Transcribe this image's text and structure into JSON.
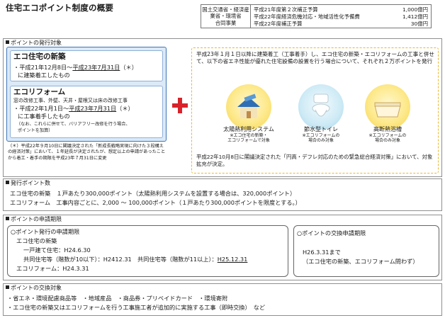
{
  "title": "住宅エコポイント制度の概要",
  "ministry": {
    "line1": "国土交通省・経済産業省・環境省",
    "line2": "合同事業"
  },
  "budget": [
    {
      "label": "平成21年度第２次補正予算",
      "amount": "1,000億円"
    },
    {
      "label": "平成22年度経済危機対応・地域活性化予備費",
      "amount": "1,412億円"
    },
    {
      "label": "平成22年度補正予算",
      "amount": "30億円"
    }
  ],
  "issue_target": {
    "heading": "ポイントの発行対象",
    "new_house": {
      "title": "エコ住宅の新築",
      "line1": "・平成21年12月8日〜",
      "line1_u": "平成23年7月31日",
      "line1_tail": "（＊）",
      "line2": "に建築着工したもの"
    },
    "reform": {
      "title": "エコリフォーム",
      "desc": "窓の改修工事、外壁、天井・屋根又は床の改修工事",
      "line1": "・平成22年1月1日〜",
      "line1_u": "平成23年7月31日",
      "line1_tail": "（＊）",
      "line2": "に工事着手したもの",
      "note1": "（なお、これらに併せて、バリアフリー改修を行う場合、",
      "note2": "ポイントを加算）"
    },
    "footnote": "（＊）平成22年９月10日に閣議決定された「新成長戦略実現に向けた３段構えの経済対策」において、１年延長が決定されたが、想定以上の申請があったことから着工・着手の期限を平成23年７月31日に変更",
    "combo_text": "平成23年１月１日以降に建築着工（工事着手）し、エコ住宅の新築・エコリフォームの工事と併せて、以下の省エネ性能が優れた住宅設備の設置を行う場合について、それぞれ２万ポイントを発行",
    "equipment": [
      {
        "icon": "solar-house-icon",
        "name": "太陽熱利用システム",
        "note1": "※エコ住宅の新築・",
        "note2": "エコリフォームで対象"
      },
      {
        "icon": "toilet-icon",
        "name": "節水型トイレ",
        "note1": "※エコリフォームの",
        "note2": "場合のみ対象"
      },
      {
        "icon": "bathtub-icon",
        "name": "高断熱浴槽",
        "note1": "※エコリフォームの",
        "note2": "場合のみ対象"
      }
    ],
    "combo_foot": "平成22年10月8日に閣議決定された「円高・デフレ対応のための緊急総合経済対策」において、対象拡充が決定。"
  },
  "issue_points": {
    "heading": "発行ポイント数",
    "line1": "エコ住宅の新築　１戸あたり300,000ポイント（太陽熱利用システムを設置する場合は、320,000ポイント）",
    "line2": "エコリフォーム　工事内容ごとに、2,000 〜 100,000ポイント（１戸あたり300,000ポイントを限度とする。）"
  },
  "application": {
    "heading": "ポイントの申請期限",
    "issue_period": {
      "title": "○ポイント発行の申請期限",
      "l1": "エコ住宅の新築",
      "l2": "一戸建て住宅：H24.6.30",
      "l3a": "共同住宅等（階数が10以下）：H2412.31　共同住宅等（階数が11以上）：",
      "l3u": "H25.12.31",
      "l4": "エコリフォーム：H24.3.31"
    },
    "exchange_period": {
      "title": "○ポイントの交換申請期限",
      "l1": "H26.3.31まで",
      "l2": "（エコ住宅の新築、エコリフォーム問わず）"
    }
  },
  "exchange_target": {
    "heading": "ポイントの交換対象",
    "line1": "・省エネ・環境配慮商品等　・地域産品　・商品券・プリペイドカード　・環境寄附",
    "line2": "・エコ住宅の新築又はエコリフォームを行う工事施工者が追加的に実施する工事（即時交換）　など"
  },
  "colors": {
    "blue_fill": "#dbe9f8",
    "blue_border": "#3f75b5",
    "plus_red": "#d8232a",
    "dash_yellow": "#e8b82f"
  }
}
